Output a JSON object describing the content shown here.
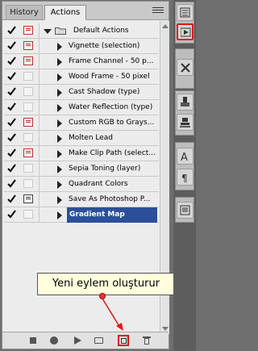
{
  "tabs": [
    {
      "label": "History",
      "active": false
    },
    {
      "label": "Actions",
      "active": true
    }
  ],
  "actions": [
    {
      "label": "Default Actions",
      "type": "set",
      "checked": true,
      "dialog": "red",
      "expanded": true
    },
    {
      "label": "Vignette (selection)",
      "type": "action",
      "checked": true,
      "dialog": "red"
    },
    {
      "label": "Frame Channel - 50 p...",
      "type": "action",
      "checked": true,
      "dialog": "red"
    },
    {
      "label": "Wood Frame - 50 pixel",
      "type": "action",
      "checked": true,
      "dialog": "none"
    },
    {
      "label": "Cast Shadow (type)",
      "type": "action",
      "checked": true,
      "dialog": "none"
    },
    {
      "label": "Water Reflection (type)",
      "type": "action",
      "checked": true,
      "dialog": "none"
    },
    {
      "label": "Custom RGB to Grays...",
      "type": "action",
      "checked": true,
      "dialog": "red"
    },
    {
      "label": "Molten Lead",
      "type": "action",
      "checked": true,
      "dialog": "none"
    },
    {
      "label": "Make Clip Path (select...",
      "type": "action",
      "checked": true,
      "dialog": "red"
    },
    {
      "label": "Sepia Toning (layer)",
      "type": "action",
      "checked": true,
      "dialog": "none"
    },
    {
      "label": "Quadrant Colors",
      "type": "action",
      "checked": true,
      "dialog": "none"
    },
    {
      "label": "Save As Photoshop P...",
      "type": "action",
      "checked": true,
      "dialog": "dark"
    },
    {
      "label": "Gradient Map",
      "type": "action",
      "checked": true,
      "dialog": "none",
      "selected": true
    }
  ],
  "tooltip": "Yeni eylem oluşturur",
  "bottom_buttons": [
    "stop-icon",
    "record-icon",
    "play-icon",
    "new-set-icon",
    "new-action-icon",
    "trash-icon"
  ],
  "colors": {
    "selection": "#2c4f9b",
    "highlight": "#e01818",
    "tooltip_bg": "#ffffdd"
  }
}
